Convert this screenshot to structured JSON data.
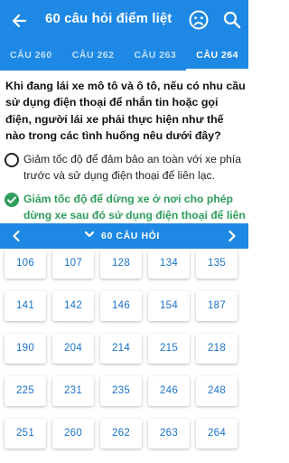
{
  "appbar": {
    "title": "60 câu hỏi điểm liệt"
  },
  "tabs": [
    "CÂU 260",
    "CÂU 262",
    "CÂU 263",
    "CÂU 264"
  ],
  "active_tab": "CÂU 264",
  "question": "Khi đang lái xe mô tô và ô tô, nếu có nhu cầu sử dụng điện thoại để nhắn tin hoặc gọi điện, người lái xe phải thực hiện như thế nào trong các tình huống nêu dưới đây?",
  "answers": [
    {
      "text": "Giảm tốc độ để đảm bảo an toàn với xe phía trước và sử dụng điện thoại để liên lạc.",
      "correct": false
    },
    {
      "text": "Giảm tốc độ để dừng xe ở nơi cho phép dừng xe sau đó sử dụng điện thoại để liên lạc.",
      "correct": true
    }
  ],
  "nav": {
    "label": "60 CÂU HỎI"
  },
  "question_numbers": [
    [
      "106",
      "107",
      "128",
      "134",
      "135"
    ],
    [
      "141",
      "142",
      "146",
      "154",
      "187"
    ],
    [
      "190",
      "204",
      "214",
      "215",
      "218"
    ],
    [
      "225",
      "231",
      "235",
      "246",
      "248"
    ],
    [
      "251",
      "260",
      "262",
      "263",
      "264"
    ]
  ],
  "colors": {
    "primary": "#1e88e5",
    "correct": "#2e9e5b",
    "number": "#1a73c9"
  },
  "icons": {
    "back": "arrow-left-icon",
    "status": "sad-face-icon",
    "search": "search-icon",
    "prev": "chevron-left-icon",
    "next": "chevron-right-icon",
    "expand": "chevron-down-icon"
  }
}
